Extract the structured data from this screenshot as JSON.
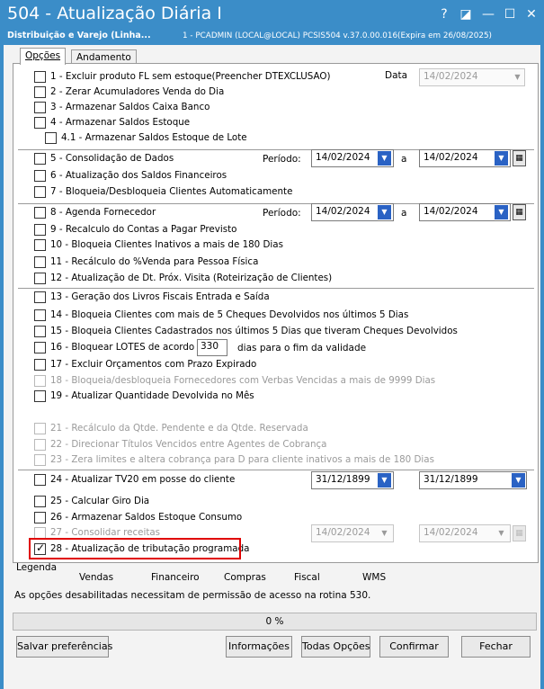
{
  "window": {
    "title": "504 - Atualização Diária I",
    "subtitle": "Distribuição e Varejo (Linha...",
    "info": "1 - PCADMIN (LOCAL@LOCAL)   PCSIS504  v.37.0.00.016(Expira em 26/08/2025)",
    "controls": [
      "?",
      "◪",
      "—",
      "☐",
      "✕"
    ]
  },
  "tabs": [
    "Opções",
    "Andamento"
  ],
  "options": [
    {
      "label": "1 - Excluir produto FL sem estoque(Preencher DTEXCLUSAO)",
      "checked": false,
      "enabled": true
    },
    {
      "label": "2 - Zerar Acumuladores Venda do Dia",
      "checked": false,
      "enabled": true
    },
    {
      "label": "3 - Armazenar Saldos Caixa Banco",
      "checked": false,
      "enabled": true
    },
    {
      "label": "4 - Armazenar Saldos Estoque",
      "checked": false,
      "enabled": true
    },
    {
      "label": "4.1 - Armazenar Saldos Estoque de Lote",
      "checked": false,
      "enabled": true
    },
    {
      "label": "5 - Consolidação de Dados",
      "checked": false,
      "enabled": true
    },
    {
      "label": "6 - Atualização dos Saldos Financeiros",
      "checked": false,
      "enabled": true
    },
    {
      "label": "7 - Bloqueia/Desbloqueia Clientes Automaticamente",
      "checked": false,
      "enabled": true
    },
    {
      "label": "8 - Agenda Fornecedor",
      "checked": false,
      "enabled": true
    },
    {
      "label": "9 - Recalculo do Contas a Pagar Previsto",
      "checked": false,
      "enabled": true
    },
    {
      "label": "10 - Bloqueia Clientes Inativos a mais de 180 Dias",
      "checked": false,
      "enabled": true
    },
    {
      "label": "11 - Recálculo do %Venda para Pessoa Física",
      "checked": false,
      "enabled": true
    },
    {
      "label": "12 - Atualização de Dt. Próx. Visita (Roteirização de Clientes)",
      "checked": false,
      "enabled": true
    },
    {
      "label": "13 - Geração dos Livros Fiscais Entrada e Saída",
      "checked": false,
      "enabled": true
    },
    {
      "label": "14 - Bloqueia Clientes com mais de 5 Cheques Devolvidos nos últimos 5  Dias",
      "checked": false,
      "enabled": true
    },
    {
      "label": "15 - Bloqueia Clientes Cadastrados nos últimos 5 Dias que tiveram Cheques Devolvidos",
      "checked": false,
      "enabled": true
    },
    {
      "label": "16 - Bloquear LOTES de acordo co",
      "checked": false,
      "enabled": true
    },
    {
      "label": "17 - Excluir Orçamentos com Prazo Expirado",
      "checked": false,
      "enabled": true
    },
    {
      "label": "18 - Bloqueia/desbloqueia Fornecedores com Verbas Vencidas a mais de 9999 Dias",
      "checked": false,
      "enabled": false
    },
    {
      "label": "19 - Atualizar Quantidade Devolvida no Mês",
      "checked": false,
      "enabled": true
    },
    {
      "label": "21 - Recálculo da Qtde. Pendente e da Qtde. Reservada",
      "checked": false,
      "enabled": false
    },
    {
      "label": "22 - Direcionar Títulos Vencidos entre Agentes de Cobrança",
      "checked": false,
      "enabled": false
    },
    {
      "label": "23 - Zera limites e altera cobrança para D  para cliente inativos a mais de 180 Dias",
      "checked": false,
      "enabled": false
    },
    {
      "label": "24 - Atualizar TV20 em posse do cliente",
      "checked": false,
      "enabled": true
    },
    {
      "label": "25 - Calcular Giro Dia",
      "checked": false,
      "enabled": true
    },
    {
      "label": "26 - Armazenar Saldos Estoque Consumo",
      "checked": false,
      "enabled": true
    },
    {
      "label": "27 - Consolidar receitas",
      "checked": false,
      "enabled": false
    },
    {
      "label": "28 - Atualização de tributação programada",
      "checked": true,
      "enabled": true
    }
  ],
  "fields": {
    "data_label": "Data",
    "data_value": "14/02/2024",
    "periodo_label": "Período:",
    "a_label": "a",
    "p5_start": "14/02/2024",
    "p5_end": "14/02/2024",
    "p8_start": "14/02/2024",
    "p8_end": "14/02/2024",
    "lotes_days": "330",
    "lotes_suffix": "dias para o fim da validade",
    "p24_start": "31/12/1899",
    "p24_end": "31/12/1899",
    "p27_start": "14/02/2024",
    "p27_end": "14/02/2024"
  },
  "legend": {
    "title": "Legenda",
    "items": [
      "Vendas",
      "Financeiro",
      "Compras",
      "Fiscal",
      "WMS"
    ]
  },
  "info_message": "As opções desabilitadas necessitam de permissão de acesso na rotina 530.",
  "progress": {
    "percent_label": "0 %",
    "value": 0
  },
  "buttons": {
    "save_prefs": "Salvar preferências",
    "info": "Informações",
    "all_options": "Todas Opções",
    "confirm": "Confirmar",
    "close": "Fechar"
  }
}
